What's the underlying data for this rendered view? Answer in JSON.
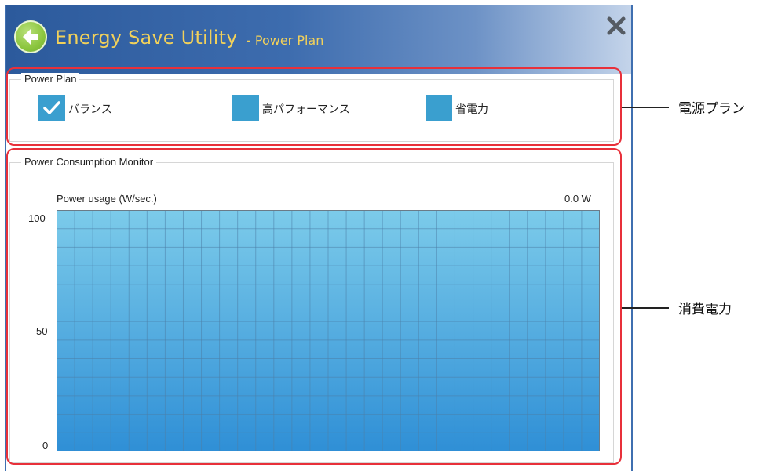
{
  "window": {
    "title": "Energy Save Utility",
    "subtitle": "- Power Plan"
  },
  "icons": {
    "back": "back-arrow-icon",
    "close": "close-icon",
    "check": "check-icon"
  },
  "power_plan": {
    "group_title": "Power Plan",
    "options": [
      {
        "label": "バランス",
        "checked": true
      },
      {
        "label": "高パフォーマンス",
        "checked": false
      },
      {
        "label": "省電力",
        "checked": false
      }
    ]
  },
  "monitor": {
    "group_title": "Power Consumption Monitor",
    "chart_label": "Power usage (W/sec.)",
    "current_value": "0.0 W"
  },
  "chart_data": {
    "type": "area",
    "ylabel": "Power usage (W/sec.)",
    "ylim": [
      0,
      100
    ],
    "y_ticks": [
      "100",
      "50",
      "0"
    ],
    "grid": true,
    "current_reading": "0.0 W"
  },
  "callouts": {
    "power_plan": "電源プラン",
    "consumption": "消費電力"
  },
  "colors": {
    "accent_title": "#f2d15a",
    "checkbox": "#3a9fcf",
    "highlight": "#e8303a"
  }
}
